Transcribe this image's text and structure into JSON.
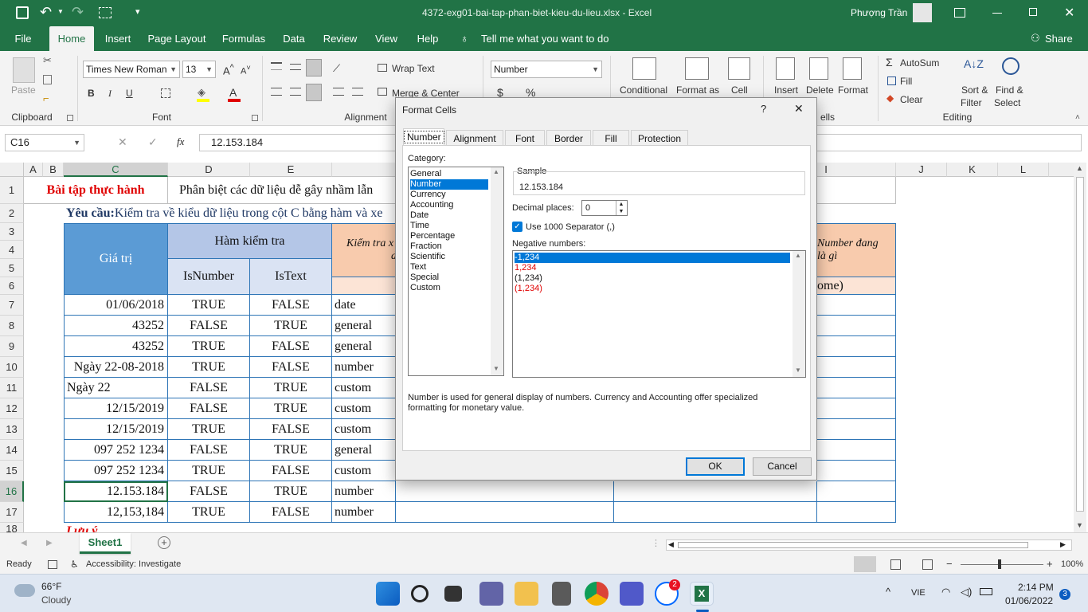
{
  "window": {
    "title": "4372-exg01-bai-tap-phan-biet-kieu-du-lieu.xlsx  -  Excel",
    "user": "Phượng Trần",
    "share": "Share"
  },
  "tabs": [
    "File",
    "Home",
    "Insert",
    "Page Layout",
    "Formulas",
    "Data",
    "Review",
    "View",
    "Help"
  ],
  "tell_me": "Tell me what you want to do",
  "ribbon": {
    "paste": "Paste",
    "clipboard": "Clipboard",
    "font_name": "Times New Roman",
    "font_size": "13",
    "font": "Font",
    "bold": "B",
    "italic": "I",
    "underline": "U",
    "wrap_text": "Wrap Text",
    "merge_center": "Merge & Center",
    "alignment": "Alignment",
    "number_format": "Number",
    "conditional": "Conditional",
    "format_as": "Format as",
    "cell": "Cell",
    "insert": "Insert",
    "delete": "Delete",
    "format": "Format",
    "cells": "ells",
    "autosum": "AutoSum",
    "fill": "Fill",
    "clear": "Clear",
    "sort": "Sort &",
    "filter": "Filter",
    "find": "Find &",
    "select": "Select",
    "editing": "Editing"
  },
  "formula_bar": {
    "name_box": "C16",
    "fx": "fx",
    "value": "12.153.184"
  },
  "columns": [
    "A",
    "B",
    "C",
    "D",
    "E",
    "I",
    "J",
    "K",
    "L"
  ],
  "rows": [
    "1",
    "2",
    "3",
    "4",
    "5",
    "6",
    "7",
    "8",
    "9",
    "10",
    "11",
    "12",
    "13",
    "14",
    "15",
    "16",
    "17",
    "18"
  ],
  "sheet": {
    "r1_title": "Bài tập thực hành",
    "r1_sub": "Phân biệt các dữ liệu dễ gây nhầm lẫn",
    "r2_label": "Yêu cầu:",
    "r2_text": " Kiểm tra về kiểu dữ liệu trong cột C bằng hàm và xe",
    "h_value": "Giá trị",
    "h_func": "Hàm kiểm tra",
    "h_isnumber": "IsNumber",
    "h_istext": "IsText",
    "h_check": "Kiểm tra x",
    "h_check2": "d",
    "h_right1": "Number đang",
    "h_right2": "là gì",
    "h_home": "ome)",
    "r18": "Lưu ý",
    "data": [
      {
        "c": "01/06/2018",
        "d": "TRUE",
        "e": "FALSE",
        "f": "date",
        "align": "right"
      },
      {
        "c": "43252",
        "d": "FALSE",
        "e": "TRUE",
        "f": "general",
        "align": "right"
      },
      {
        "c": "43252",
        "d": "TRUE",
        "e": "FALSE",
        "f": "general",
        "align": "right"
      },
      {
        "c": "Ngày 22-08-2018",
        "d": "TRUE",
        "e": "FALSE",
        "f": "number",
        "align": "right"
      },
      {
        "c": "Ngày 22",
        "d": "FALSE",
        "e": "TRUE",
        "f": "custom",
        "align": "left"
      },
      {
        "c": "12/15/2019",
        "d": "FALSE",
        "e": "TRUE",
        "f": "custom",
        "align": "right"
      },
      {
        "c": "12/15/2019",
        "d": "TRUE",
        "e": "FALSE",
        "f": "custom",
        "align": "right"
      },
      {
        "c": "097 252 1234",
        "d": "FALSE",
        "e": "TRUE",
        "f": "general",
        "align": "right"
      },
      {
        "c": "097 252 1234",
        "d": "TRUE",
        "e": "FALSE",
        "f": "custom",
        "align": "right"
      },
      {
        "c": "12.153.184",
        "d": "FALSE",
        "e": "TRUE",
        "f": "number",
        "align": "right"
      },
      {
        "c": "12,153,184",
        "d": "TRUE",
        "e": "FALSE",
        "f": "number",
        "align": "right"
      }
    ]
  },
  "sheet_tab": "Sheet1",
  "status": {
    "ready": "Ready",
    "accessibility": "Accessibility: Investigate",
    "zoom": "100%"
  },
  "dialog": {
    "title": "Format Cells",
    "help": "?",
    "close": "✕",
    "tabs": [
      "Number",
      "Alignment",
      "Font",
      "Border",
      "Fill",
      "Protection"
    ],
    "category_label": "Category:",
    "categories": [
      "General",
      "Number",
      "Currency",
      "Accounting",
      "Date",
      "Time",
      "Percentage",
      "Fraction",
      "Scientific",
      "Text",
      "Special",
      "Custom"
    ],
    "sample_label": "Sample",
    "sample_value": "12.153.184",
    "decimal_label": "Decimal places:",
    "decimal_value": "0",
    "separator_label": "Use 1000 Separator (,)",
    "negative_label": "Negative numbers:",
    "negatives": [
      "-1,234",
      "1,234",
      "(1,234)",
      "(1,234)"
    ],
    "description": "Number is used for general display of numbers.  Currency and Accounting offer specialized formatting for monetary value.",
    "ok": "OK",
    "cancel": "Cancel"
  },
  "taskbar": {
    "temp": "66°F",
    "weather": "Cloudy",
    "lang": "VIE",
    "time": "2:14 PM",
    "date": "01/06/2022",
    "badge": "2",
    "notif": "3"
  },
  "colors": {
    "excel_green": "#217346",
    "header_blue": "#5b9bd5",
    "header_light": "#b4c6e7",
    "accent_red": "#e00000",
    "row_peach": "#fce4d6",
    "select_blue": "#0078d7"
  }
}
